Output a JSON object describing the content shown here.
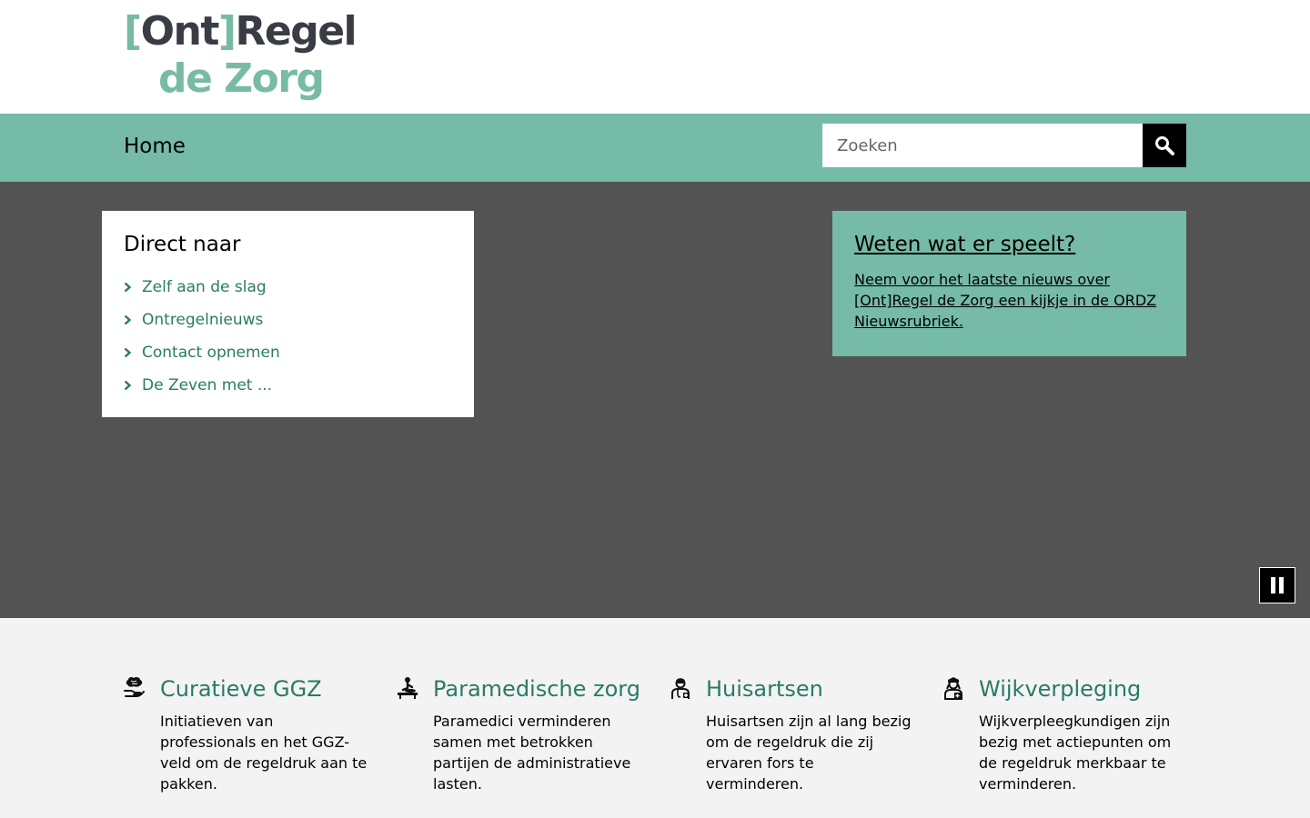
{
  "logo": {
    "line1_open": "[",
    "line1_ont": "Ont",
    "line1_close": "]",
    "line1_regel": "Regel",
    "line2": "de Zorg"
  },
  "nav": {
    "home": "Home",
    "search_placeholder": "Zoeken"
  },
  "direct": {
    "title": "Direct naar",
    "items": [
      {
        "label": "Zelf aan de slag"
      },
      {
        "label": "Ontregelnieuws"
      },
      {
        "label": "Contact opnemen"
      },
      {
        "label": "De Zeven met ..."
      }
    ]
  },
  "news": {
    "title": "Weten wat er speelt?",
    "text": "Neem voor het laatste nieuws over [Ont]Regel de Zorg een kijkje in de ORDZ Nieuwsrubriek."
  },
  "tiles": [
    {
      "title": "Curatieve GGZ",
      "desc": "Initiatieven van professionals en het GGZ-veld om de regeldruk aan te pakken.",
      "icon": "brain-hand-icon"
    },
    {
      "title": "Paramedische zorg",
      "desc": "Paramedici verminderen samen met betrokken partijen de administratieve lasten.",
      "icon": "massage-table-icon"
    },
    {
      "title": "Huisartsen",
      "desc": "Huisartsen zijn al lang bezig om de regeldruk die zij ervaren fors te verminderen.",
      "icon": "doctor-icon"
    },
    {
      "title": "Wijkverpleging",
      "desc": "Wijkverpleegkundigen zijn bezig met actiepunten om de regeldruk merkbaar te verminderen.",
      "icon": "nurse-icon"
    }
  ],
  "colors": {
    "accent": "#76bba7",
    "logo_dark": "#3a3c45",
    "link": "#2a7a68",
    "hero_bg": "#535353"
  }
}
